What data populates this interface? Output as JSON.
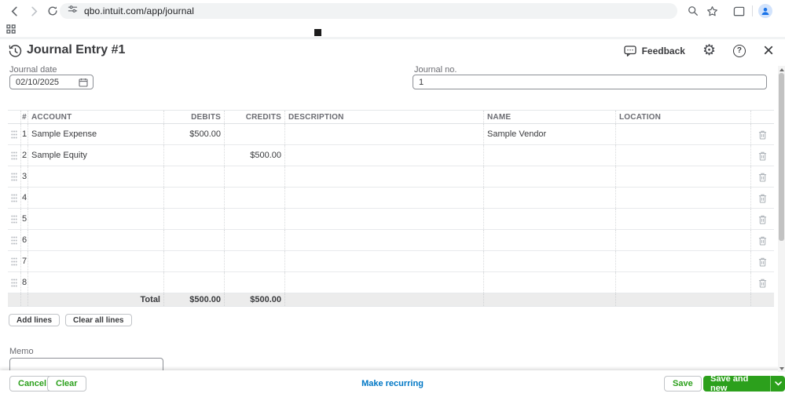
{
  "browser": {
    "url": "qbo.intuit.com/app/journal"
  },
  "page": {
    "title": "Journal Entry #1",
    "feedback_label": "Feedback"
  },
  "form": {
    "journal_date_label": "Journal date",
    "journal_date_value": "02/10/2025",
    "journal_no_label": "Journal no.",
    "journal_no_value": "1"
  },
  "table": {
    "headers": {
      "num": "#",
      "account": "ACCOUNT",
      "debits": "DEBITS",
      "credits": "CREDITS",
      "description": "DESCRIPTION",
      "name": "NAME",
      "location": "LOCATION"
    },
    "rows": [
      {
        "num": "1",
        "account": "Sample Expense",
        "debits": "$500.00",
        "credits": "",
        "description": "",
        "name": "Sample Vendor",
        "location": ""
      },
      {
        "num": "2",
        "account": "Sample Equity",
        "debits": "",
        "credits": "$500.00",
        "description": "",
        "name": "",
        "location": ""
      },
      {
        "num": "3",
        "account": "",
        "debits": "",
        "credits": "",
        "description": "",
        "name": "",
        "location": ""
      },
      {
        "num": "4",
        "account": "",
        "debits": "",
        "credits": "",
        "description": "",
        "name": "",
        "location": ""
      },
      {
        "num": "5",
        "account": "",
        "debits": "",
        "credits": "",
        "description": "",
        "name": "",
        "location": ""
      },
      {
        "num": "6",
        "account": "",
        "debits": "",
        "credits": "",
        "description": "",
        "name": "",
        "location": ""
      },
      {
        "num": "7",
        "account": "",
        "debits": "",
        "credits": "",
        "description": "",
        "name": "",
        "location": ""
      },
      {
        "num": "8",
        "account": "",
        "debits": "",
        "credits": "",
        "description": "",
        "name": "",
        "location": ""
      }
    ],
    "total": {
      "label": "Total",
      "debits": "$500.00",
      "credits": "$500.00"
    }
  },
  "line_actions": {
    "add_lines": "Add lines",
    "clear_all_lines": "Clear all lines"
  },
  "memo": {
    "label": "Memo",
    "value": ""
  },
  "footer": {
    "cancel": "Cancel",
    "clear": "Clear",
    "make_recurring": "Make recurring",
    "save": "Save",
    "save_and_new": "Save and new"
  },
  "colors": {
    "qb_green": "#2ca01c",
    "qb_blue": "#0077c5",
    "text_dark": "#393a3d",
    "label_gray": "#6b6c72"
  }
}
